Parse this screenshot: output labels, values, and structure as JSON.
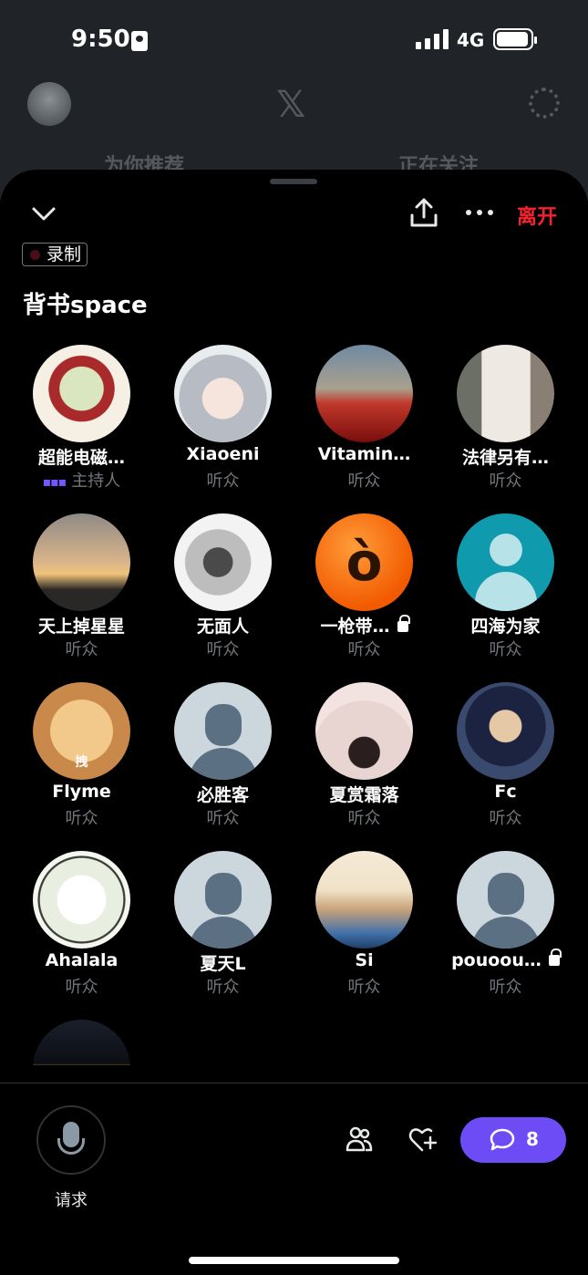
{
  "status_bar": {
    "time": "9:50",
    "network": "4G"
  },
  "app_header": {
    "logo": "𝕏",
    "tabs": [
      "为你推荐",
      "正在关注"
    ]
  },
  "sheet": {
    "actions": {
      "leave_label": "离开"
    },
    "recording_badge": "录制",
    "space_title": "背书space"
  },
  "participants": [
    {
      "name": "超能电磁…",
      "role": "主持人",
      "speaking": true,
      "avatar": "anime-girl-flowers"
    },
    {
      "name": "Xiaoeni",
      "role": "听众",
      "avatar": "anime-girl-silver"
    },
    {
      "name": "Vitamin…",
      "role": "听众",
      "avatar": "astronaut-poppies"
    },
    {
      "name": "法律另有…",
      "role": "听众",
      "avatar": "woman-portrait"
    },
    {
      "name": "天上掉星星",
      "role": "听众",
      "avatar": "sunset-tower"
    },
    {
      "name": "无面人",
      "role": "听众",
      "avatar": "sketch-man"
    },
    {
      "name": "一枪带…",
      "role": "听众",
      "locked": true,
      "avatar": "angry-emoji"
    },
    {
      "name": "四海为家",
      "role": "听众",
      "avatar": "default-teal"
    },
    {
      "name": "Flyme",
      "role": "听众",
      "avatar": "cat",
      "avatar_text": "拽"
    },
    {
      "name": "必胜客",
      "role": "听众",
      "avatar": "default"
    },
    {
      "name": "夏赏霜落",
      "role": "听众",
      "avatar": "pink-birds"
    },
    {
      "name": "Fc",
      "role": "听众",
      "avatar": "anime-boy"
    },
    {
      "name": "Ahalala",
      "role": "听众",
      "avatar": "sketch-anime"
    },
    {
      "name": "夏天L",
      "role": "听众",
      "avatar": "default"
    },
    {
      "name": "Si",
      "role": "听众",
      "avatar": "landscape-tree"
    },
    {
      "name": "pouoou…",
      "role": "听众",
      "locked": true,
      "avatar": "default"
    },
    {
      "name": "",
      "role": "",
      "avatar": "night-water"
    }
  ],
  "bottom_bar": {
    "request_label": "请求",
    "chat_count": "8"
  },
  "icons": [
    "chevron-down-icon",
    "share-icon",
    "more-icon",
    "microphone-icon",
    "people-icon",
    "heart-plus-icon",
    "chat-bubble-icon",
    "lock-icon"
  ],
  "colors": {
    "leave": "#f4212e",
    "accent": "#6e4cf5",
    "host_wave": "#7856ff"
  }
}
